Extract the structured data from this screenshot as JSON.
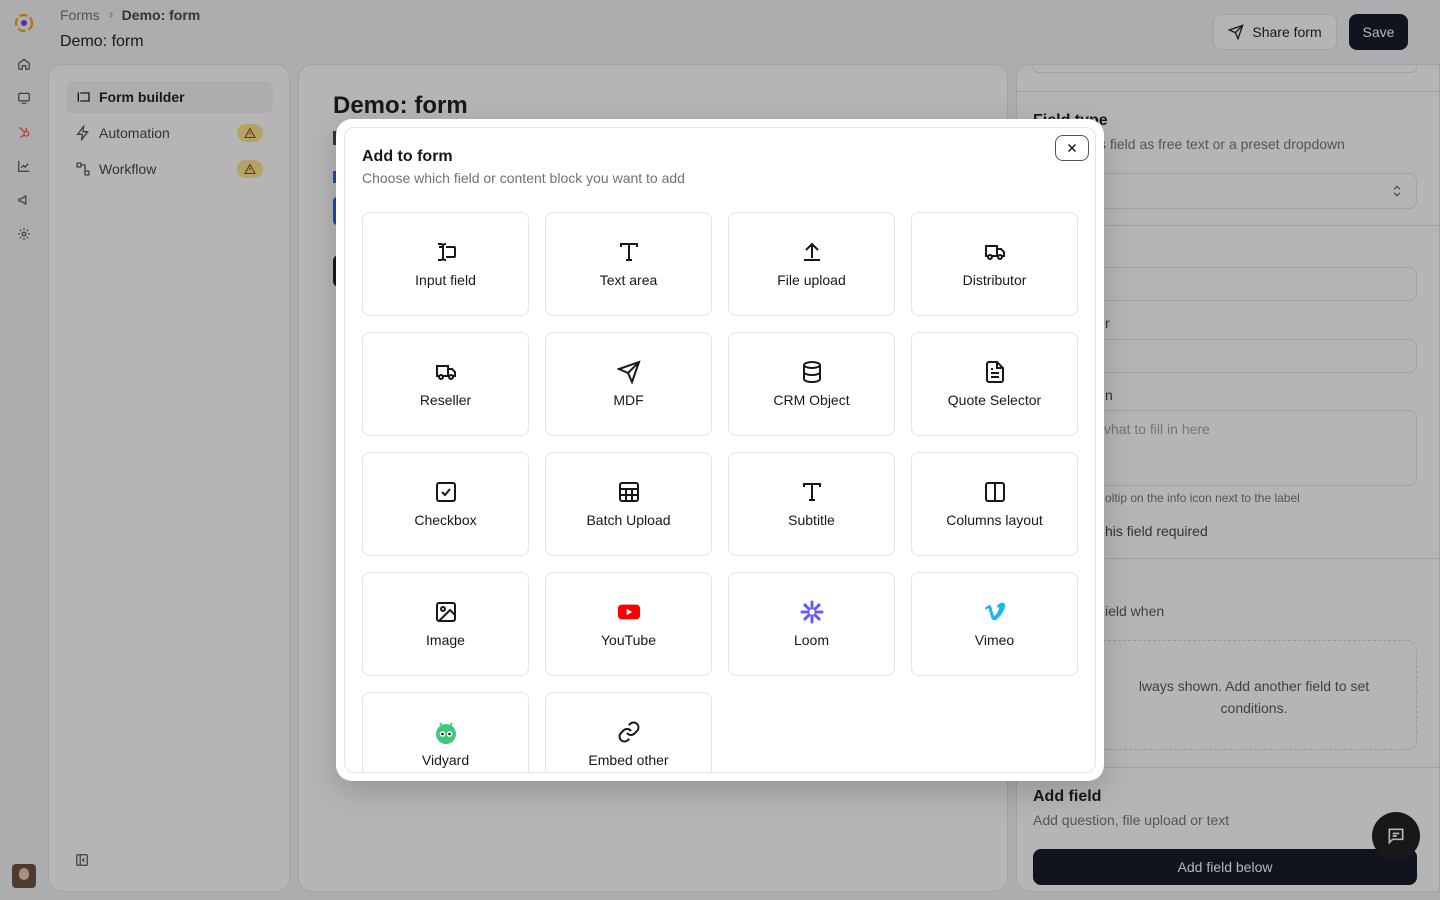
{
  "breadcrumb": {
    "root": "Forms",
    "current": "Demo: form"
  },
  "header": {
    "title": "Demo: form",
    "share_label": "Share form",
    "save_label": "Save"
  },
  "sidebar": {
    "items": [
      {
        "label": "Form builder",
        "icon": "form-builder-icon",
        "active": true
      },
      {
        "label": "Automation",
        "icon": "lightning-icon",
        "warning": true
      },
      {
        "label": "Workflow",
        "icon": "workflow-icon",
        "warning": true
      }
    ]
  },
  "center": {
    "title": "Demo: form"
  },
  "right_panel": {
    "field_type_title": "Field type",
    "field_type_desc": "s field as free text or a preset dropdown",
    "label_fragment": "r",
    "description_fragment": "n",
    "description_placeholder": "vhat to fill in here",
    "tooltip_hint": "oltip on the info icon next to the label",
    "required_label": "his field required",
    "show_when_label": "ield when",
    "always_shown_text": "lways shown. Add another field to set conditions.",
    "add_field_title": "Add field",
    "add_field_desc": "Add question, file upload or text",
    "add_field_button": "Add field below"
  },
  "modal": {
    "title": "Add to form",
    "subtitle": "Choose which field or content block you want to add",
    "tiles": [
      {
        "label": "Input field",
        "icon": "input-field-icon"
      },
      {
        "label": "Text area",
        "icon": "text-icon"
      },
      {
        "label": "File upload",
        "icon": "upload-icon"
      },
      {
        "label": "Distributor",
        "icon": "truck-icon"
      },
      {
        "label": "Reseller",
        "icon": "truck-icon"
      },
      {
        "label": "MDF",
        "icon": "send-icon"
      },
      {
        "label": "CRM Object",
        "icon": "database-icon"
      },
      {
        "label": "Quote Selector",
        "icon": "document-icon"
      },
      {
        "label": "Checkbox",
        "icon": "checkbox-icon"
      },
      {
        "label": "Batch Upload",
        "icon": "table-icon"
      },
      {
        "label": "Subtitle",
        "icon": "text-icon"
      },
      {
        "label": "Columns layout",
        "icon": "columns-icon"
      },
      {
        "label": "Image",
        "icon": "image-icon"
      },
      {
        "label": "YouTube",
        "icon": "youtube-icon"
      },
      {
        "label": "Loom",
        "icon": "loom-icon"
      },
      {
        "label": "Vimeo",
        "icon": "vimeo-icon"
      },
      {
        "label": "Vidyard",
        "icon": "vidyard-icon"
      },
      {
        "label": "Embed other",
        "icon": "link-icon"
      }
    ]
  },
  "colors": {
    "primary": "#0b1220",
    "warning_badge": "#fde68a",
    "youtube": "#ff0000",
    "loom": "#625df5",
    "vimeo": "#1ab7ea",
    "vidyard": "#3ec97e",
    "brand_hubspot": "#ff5c35"
  }
}
